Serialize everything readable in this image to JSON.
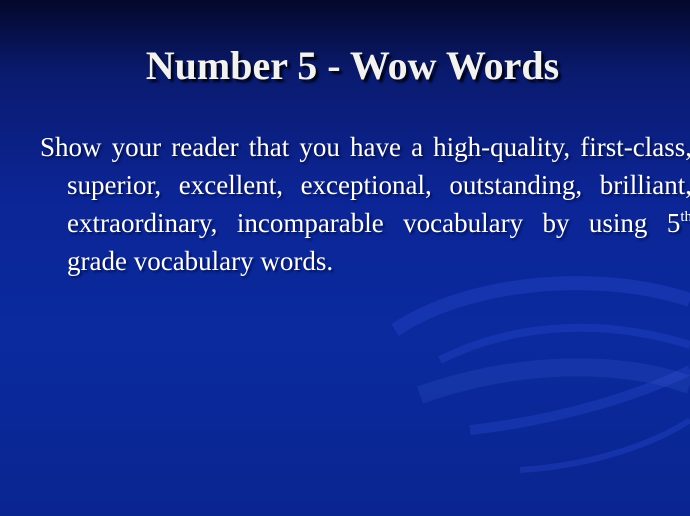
{
  "slide": {
    "title": "Number 5 - Wow Words",
    "body_before_sup": "Show your reader that you have a high-quality, first-class, superior, excellent, exceptional, outstanding, brilliant, extraordinary, incomparable vocabulary by using 5",
    "body_sup": "th",
    "body_after_sup": " grade vocabulary words."
  },
  "colors": {
    "background_top": "#04082a",
    "background_main": "#0c2596",
    "text": "#ffffff"
  }
}
